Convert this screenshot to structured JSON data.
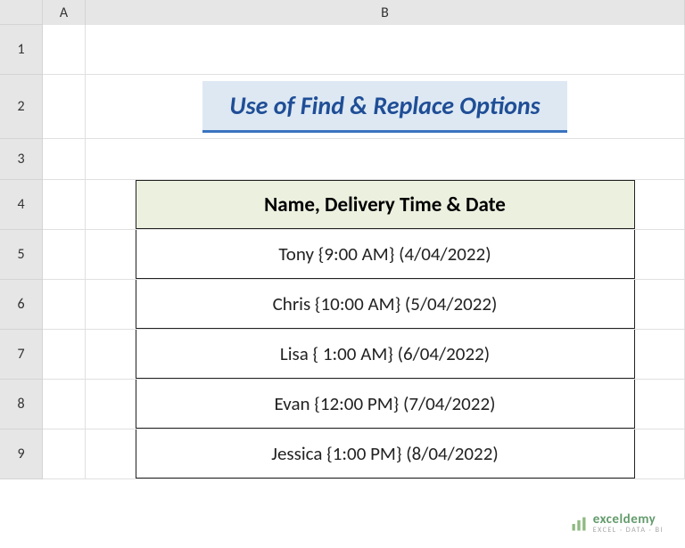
{
  "columns": {
    "a": "A",
    "b": "B"
  },
  "rows": {
    "r1": "1",
    "r2": "2",
    "r3": "3",
    "r4": "4",
    "r5": "5",
    "r6": "6",
    "r7": "7",
    "r8": "8",
    "r9": "9"
  },
  "title": "Use of Find & Replace Options",
  "table_header": "Name, Delivery Time & Date",
  "data": [
    "Tony {9:00 AM}  (4/04/2022)",
    "Chris {10:00 AM}  (5/04/2022)",
    "Lisa { 1:00 AM}  (6/04/2022)",
    "Evan {12:00 PM} (7/04/2022)",
    "Jessica {1:00 PM} (8/04/2022)"
  ],
  "watermark": {
    "brand": "exceldemy",
    "tagline": "EXCEL · DATA · BI"
  }
}
